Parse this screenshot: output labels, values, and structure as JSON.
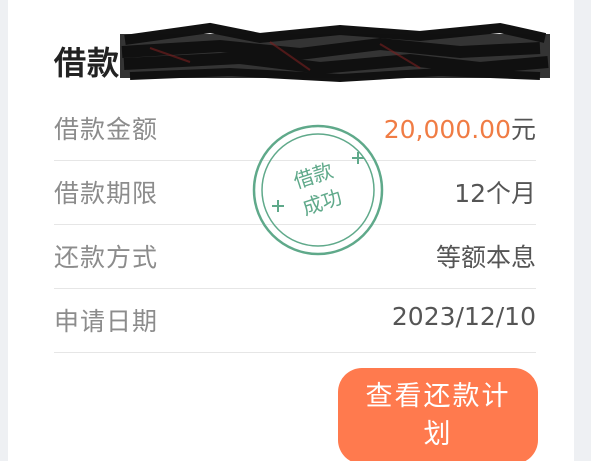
{
  "header": {
    "title": "借款",
    "title_redacted": true
  },
  "details": [
    {
      "label": "借款金额",
      "value": "20,000.00",
      "unit": "元"
    },
    {
      "label": "借款期限",
      "value": "12个月"
    },
    {
      "label": "还款方式",
      "value": "等额本息"
    },
    {
      "label": "申请日期",
      "value": "2023/12/10"
    }
  ],
  "stamp": {
    "line1": "借款",
    "line2": "成功",
    "color": "#5fa98a"
  },
  "button": {
    "label": "查看还款计划"
  },
  "colors": {
    "accent": "#ff7a4e",
    "amount": "#f07c44"
  }
}
